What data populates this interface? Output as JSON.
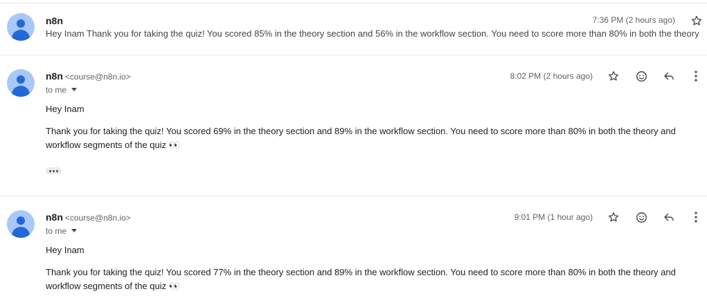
{
  "messages": [
    {
      "sender": "n8n",
      "time": "7:36 PM (2 hours ago)",
      "snippet": "Hey Inam Thank you for taking the quiz! You scored 85% in the theory section and 56% in the workflow section. You need to score more than 80% in both the theory"
    },
    {
      "sender": "n8n",
      "email": "<course@n8n.io>",
      "time": "8:02 PM (2 hours ago)",
      "to": "to me",
      "greeting": "Hey Inam",
      "body": "Thank you for taking the quiz! You scored 69% in the theory section and 89% in the workflow section. You need to score more than 80% in both the theory and workflow segments of the quiz 👀"
    },
    {
      "sender": "n8n",
      "email": "<course@n8n.io>",
      "time": "9:01 PM (1 hour ago)",
      "to": "to me",
      "greeting": "Hey Inam",
      "body": "Thank you for taking the quiz! You scored 77% in the theory section and 89% in the workflow section. You need to score more than 80% in both the theory and workflow segments of the quiz 👀"
    }
  ],
  "icons": {
    "star": "star-icon",
    "emoji": "emoji-react-icon",
    "reply": "reply-icon",
    "more": "more-vert-icon",
    "trimmed": "show-trimmed-content-icon",
    "avatar": "avatar-icon"
  },
  "colors": {
    "avatar_bg": "#a8c7fa",
    "avatar_fg": "#0b57d0",
    "divider": "#e8eaed",
    "text_secondary": "#5f6368"
  }
}
